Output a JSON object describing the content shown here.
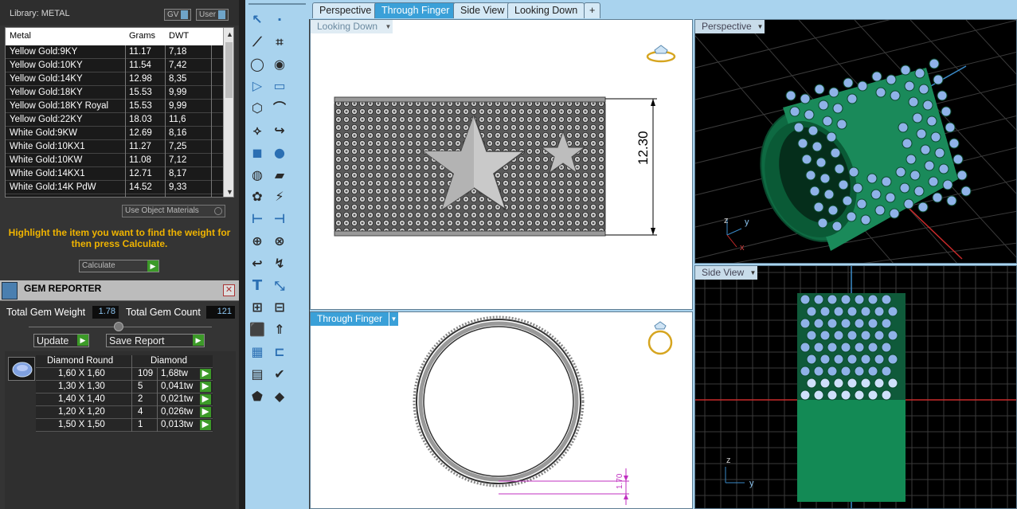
{
  "library": {
    "title": "Library: METAL",
    "gv_label": "GV",
    "user_label": "User",
    "columns": [
      "Metal",
      "Grams",
      "DWT"
    ],
    "rows": [
      {
        "metal": "Yellow Gold:9KY",
        "grams": "11.17",
        "dwt": "7,18"
      },
      {
        "metal": "Yellow Gold:10KY",
        "grams": "11.54",
        "dwt": "7,42"
      },
      {
        "metal": "Yellow Gold:14KY",
        "grams": "12.98",
        "dwt": "8,35"
      },
      {
        "metal": "Yellow Gold:18KY",
        "grams": "15.53",
        "dwt": "9,99"
      },
      {
        "metal": "Yellow Gold:18KY Royal",
        "grams": "15.53",
        "dwt": "9,99"
      },
      {
        "metal": "Yellow Gold:22KY",
        "grams": "18.03",
        "dwt": "11,6"
      },
      {
        "metal": "White Gold:9KW",
        "grams": "12.69",
        "dwt": "8,16"
      },
      {
        "metal": "White Gold:10KX1",
        "grams": "11.27",
        "dwt": "7,25"
      },
      {
        "metal": "White Gold:10KW",
        "grams": "11.08",
        "dwt": "7,12"
      },
      {
        "metal": "White Gold:14KX1",
        "grams": "12.71",
        "dwt": "8,17"
      },
      {
        "metal": "White Gold:14K PdW",
        "grams": "14.52",
        "dwt": "9,33"
      }
    ],
    "use_object_materials": "Use Object Materials",
    "hint": "Highlight the item you want to find the weight for then press Calculate.",
    "calculate_label": "Calculate"
  },
  "gem_reporter": {
    "title": "GEM REPORTER",
    "total_weight_label": "Total Gem Weight",
    "total_weight": "1.78",
    "total_count_label": "Total Gem Count",
    "total_count": "121",
    "update_label": "Update",
    "save_report_label": "Save Report",
    "columns": [
      "Diamond Round",
      "Diamond"
    ],
    "rows": [
      {
        "size": "1,60 X 1,60",
        "count": "109",
        "weight": "1,68tw"
      },
      {
        "size": "1,30 X 1,30",
        "count": "5",
        "weight": "0,041tw"
      },
      {
        "size": "1,40 X 1,40",
        "count": "2",
        "weight": "0,021tw"
      },
      {
        "size": "1,20 X 1,20",
        "count": "4",
        "weight": "0,026tw"
      },
      {
        "size": "1,50 X 1,50",
        "count": "1",
        "weight": "0,013tw"
      }
    ]
  },
  "tabs": [
    "Perspective",
    "Through Finger",
    "Side View",
    "Looking Down",
    "+"
  ],
  "active_tab": "Through Finger",
  "viewports": {
    "looking_down": {
      "label": "Looking Down",
      "dimension": "12.30"
    },
    "through_finger": {
      "label": "Through Finger",
      "dimension": "1.70"
    },
    "perspective": {
      "label": "Perspective",
      "axis_z": "z",
      "axis_y": "y",
      "axis_x": "x"
    },
    "side_view": {
      "label": "Side View",
      "axis_z": "z",
      "axis_y": "y"
    }
  },
  "colors": {
    "toolbar_bg": "#a9d3ee",
    "active_tab": "#3aa0d8",
    "ring_green": "#1a8a5a",
    "gem_blue": "#8fb2e8",
    "hint_yellow": "#f0b400",
    "go_green": "#3c9a28"
  },
  "tools": [
    "select-arrow-icon",
    "point-icon",
    "polyline-icon",
    "multi-point-icon",
    "circle-icon",
    "ellipse-icon",
    "polygon-icon",
    "rectangle-icon",
    "hexagon-icon",
    "arc-icon",
    "edit-points-icon",
    "fillet-icon",
    "box-icon",
    "spheres-icon",
    "cylinder-icon",
    "plane-icon",
    "gem-settings-icon",
    "prongs-icon",
    "trim-icon",
    "split-icon",
    "boolean-icon",
    "group-icon",
    "curve-icon",
    "curve-edit-icon",
    "text-icon",
    "scale-icon",
    "array-icon",
    "distribute-icon",
    "cube-icon",
    "extrude-icon",
    "grid-icon",
    "align-icon",
    "card-icon",
    "check-icon",
    "shape-icon",
    "paint-icon"
  ]
}
